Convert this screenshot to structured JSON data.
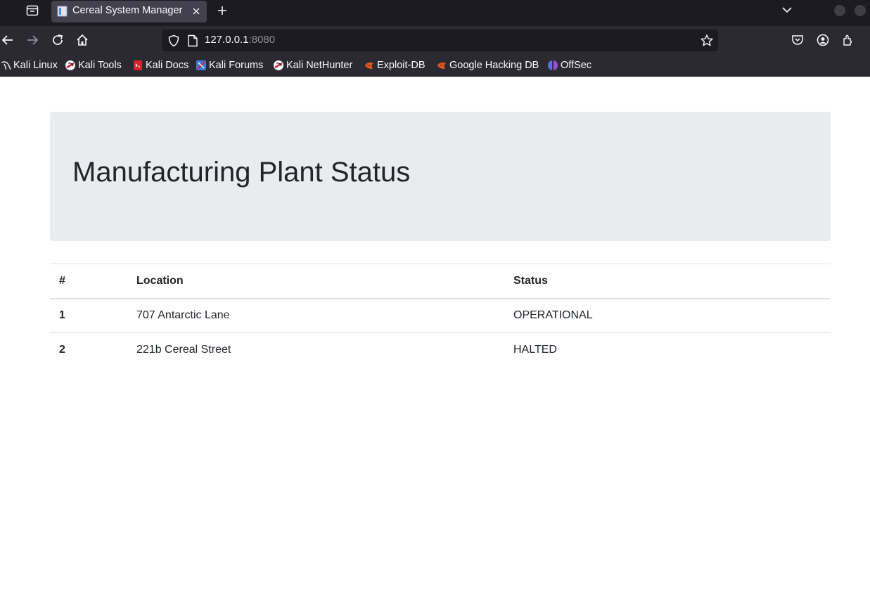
{
  "browser": {
    "tab": {
      "title": "Cereal System Manager"
    },
    "url": {
      "host": "127.0.0.1",
      "port": ":8080"
    },
    "bookmarks": [
      {
        "label": "Kali Linux",
        "icon": "kali-dragon-icon"
      },
      {
        "label": "Kali Tools",
        "icon": "kali-tools-icon"
      },
      {
        "label": "Kali Docs",
        "icon": "kali-docs-icon"
      },
      {
        "label": "Kali Forums",
        "icon": "kali-forums-icon"
      },
      {
        "label": "Kali NetHunter",
        "icon": "kali-nethunter-icon"
      },
      {
        "label": "Exploit-DB",
        "icon": "exploit-db-icon"
      },
      {
        "label": "Google Hacking DB",
        "icon": "ghdb-icon"
      },
      {
        "label": "OffSec",
        "icon": "offsec-icon"
      }
    ]
  },
  "page": {
    "title": "Manufacturing Plant Status",
    "table": {
      "headers": [
        "#",
        "Location",
        "Status"
      ],
      "rows": [
        {
          "id": "1",
          "location": "707 Antarctic Lane",
          "status": "OPERATIONAL"
        },
        {
          "id": "2",
          "location": "221b Cereal Street",
          "status": "HALTED"
        }
      ]
    }
  }
}
